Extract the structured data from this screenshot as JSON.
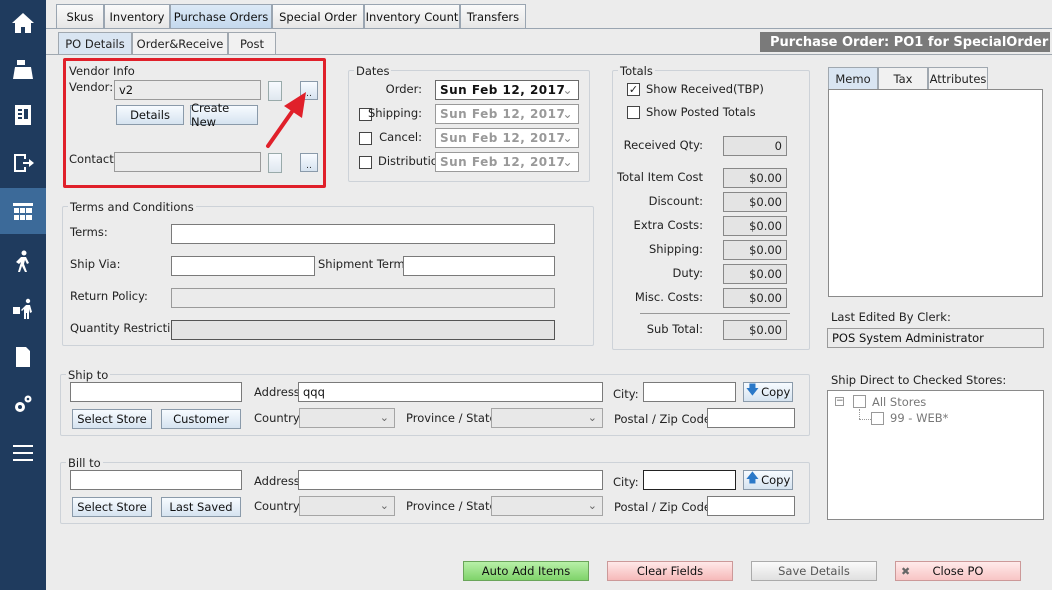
{
  "sidebar": {
    "items": [
      {
        "icon": "home-icon"
      },
      {
        "icon": "cash-register-icon"
      },
      {
        "icon": "receipt-icon"
      },
      {
        "icon": "exit-icon"
      },
      {
        "icon": "inventory-icon"
      },
      {
        "icon": "customers-icon"
      },
      {
        "icon": "delivery-icon"
      },
      {
        "icon": "reports-icon"
      },
      {
        "icon": "settings-icon"
      },
      {
        "icon": "menu-icon"
      }
    ]
  },
  "tabs": [
    "Skus",
    "Inventory",
    "Purchase Orders",
    "Special Order",
    "Inventory Count",
    "Transfers"
  ],
  "subtabs": [
    "PO Details",
    "Order&Receive",
    "Post"
  ],
  "header_title": "Purchase Order:  PO1 for SpecialOrder",
  "vendor": {
    "group_label": "Vendor Info",
    "vendor_label": "Vendor:",
    "vendor_value": "v2",
    "details_btn": "Details",
    "create_btn": "Create New",
    "contact_label": "Contact:",
    "dots": ".."
  },
  "dates": {
    "group_label": "Dates",
    "rows": [
      {
        "label": "Order:",
        "value": "Sun  Feb 12, 2017",
        "checked": false
      },
      {
        "label": "Shipping:",
        "value": "Sun  Feb 12, 2017",
        "checked": false
      },
      {
        "label": "Cancel:",
        "value": "Sun  Feb 12, 2017",
        "checked": false
      },
      {
        "label": "Distribution:",
        "value": "Sun  Feb 12, 2017",
        "checked": false
      }
    ]
  },
  "totals": {
    "group_label": "Totals",
    "show_received": "Show Received(TBP)",
    "show_received_checked": true,
    "show_posted": "Show Posted Totals",
    "show_posted_checked": false,
    "received_qty_label": "Received Qty:",
    "received_qty": "0",
    "rows": [
      {
        "label": "Total Item Cost",
        "value": "$0.00"
      },
      {
        "label": "Discount:",
        "value": "$0.00"
      },
      {
        "label": "Extra Costs:",
        "value": "$0.00"
      },
      {
        "label": "Shipping:",
        "value": "$0.00"
      },
      {
        "label": "Duty:",
        "value": "$0.00"
      },
      {
        "label": "Misc. Costs:",
        "value": "$0.00"
      }
    ],
    "subtotal_label": "Sub Total:",
    "subtotal": "$0.00"
  },
  "side_tabs": [
    "Memo",
    "Tax",
    "Attributes"
  ],
  "last_edited_label": "Last Edited By Clerk:",
  "last_edited_value": "POS System Administrator",
  "ship_direct_label": "Ship Direct to Checked Stores:",
  "stores_root": "All Stores",
  "stores_child": "99 - WEB*",
  "terms": {
    "group_label": "Terms and Conditions",
    "terms_label": "Terms:",
    "ship_via_label": "Ship Via:",
    "shipment_terms_label": "Shipment Terms:",
    "return_policy_label": "Return Policy:",
    "quantity_restriction_label": "Quantity Restriction:"
  },
  "ship_to": {
    "group_label": "Ship to",
    "address_label": "Address:",
    "address_value": "qqq",
    "city_label": "City:",
    "copy_btn": "Copy",
    "select_store_btn": "Select Store",
    "second_btn": "Customer",
    "country_label": "Country:",
    "province_label": "Province / State:",
    "postal_label": "Postal / Zip Code:"
  },
  "bill_to": {
    "group_label": "Bill to",
    "address_label": "Address:",
    "address_value": "",
    "city_label": "City:",
    "copy_btn": "Copy",
    "select_store_btn": "Select Store",
    "second_btn": "Last Saved",
    "country_label": "Country:",
    "province_label": "Province / State:",
    "postal_label": "Postal / Zip Code:"
  },
  "actions": {
    "auto_add": "Auto Add Items",
    "clear": "Clear Fields",
    "save": "Save Details",
    "close": "Close PO"
  },
  "colors": {
    "sidebar": "#1f3b5e",
    "sidebar_active": "#3c6a99",
    "highlight": "#e0202a"
  }
}
